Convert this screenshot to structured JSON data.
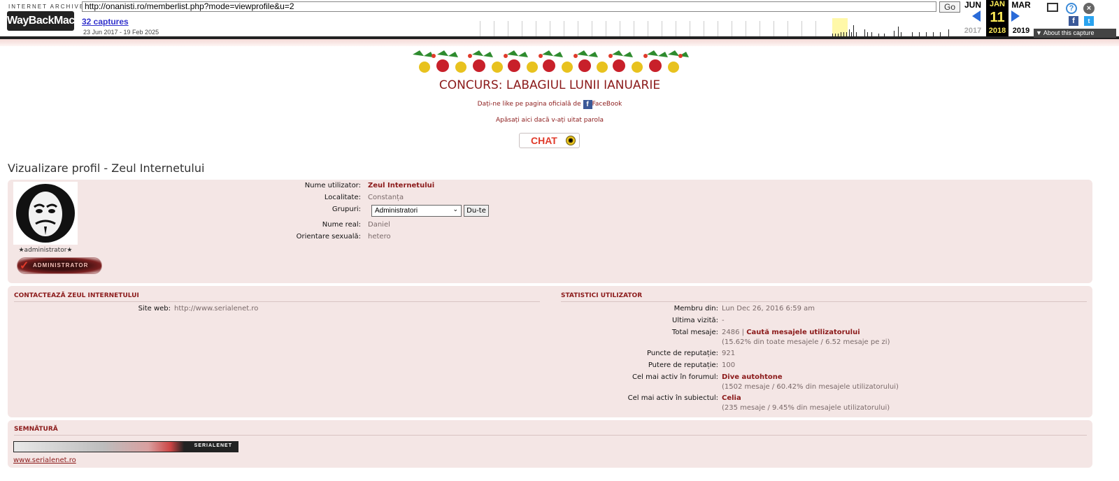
{
  "wayback": {
    "logo_top": "INTERNET ARCHIVE",
    "logo": "WayBackMachine",
    "url": "http://onanisti.ro/memberlist.php?mode=viewprofile&u=2",
    "go": "Go",
    "captures": "32 captures",
    "range": "23 Jun 2017 - 19 Feb 2025",
    "prev_month": "JUN",
    "cur_month": "JAN",
    "next_month": "MAR",
    "cur_day": "11",
    "prev_year": "2017",
    "cur_year": "2018",
    "next_year": "2019",
    "about": "▼ About this capture"
  },
  "header": {
    "contest": "CONCURS: LABAGIUL LUNII IANUARIE",
    "like_prefix": "Dați-ne like pe pagina oficială de",
    "like_suffix": "FaceBook",
    "forgot": "Apăsați aici dacă v-ați uitat parola",
    "chat": "CHAT"
  },
  "page_title": "Vizualizare profil - Zeul Internetului",
  "profile": {
    "rank_text": "★administrator★",
    "rank_image": "ADMINISTRATOR",
    "fields": [
      {
        "label": "Nume utilizator:",
        "value": "Zeul Internetului"
      },
      {
        "label": "Localitate:",
        "value": "Constanța"
      },
      {
        "label": "Grupuri:",
        "value": "Administratori"
      },
      {
        "label": "Nume real:",
        "value": "Daniel"
      },
      {
        "label": "Orientare sexuală:",
        "value": "hetero"
      }
    ],
    "go_button": "Du-te"
  },
  "contact": {
    "title": "CONTACTEAZĂ ZEUL INTERNETULUI",
    "site_label": "Site web:",
    "site_value": "http://www.serialenet.ro"
  },
  "stats": {
    "title": "STATISTICI UTILIZATOR",
    "member_since_label": "Membru din:",
    "member_since": "Lun Dec 26, 2016 6:59 am",
    "last_visit_label": "Ultima vizită:",
    "last_visit": "-",
    "total_posts_label": "Total mesaje:",
    "total_posts": "2486",
    "separator": "|",
    "search_posts": "Caută mesajele utilizatorului",
    "total_posts_sub": "(15.62% din toate mesajele / 6.52 mesaje pe zi)",
    "rep_points_label": "Puncte de reputație:",
    "rep_points": "921",
    "rep_power_label": "Putere de reputație:",
    "rep_power": "100",
    "active_forum_label": "Cel mai activ în forumul:",
    "active_forum": "Dive autohtone",
    "active_forum_sub": "(1502 mesaje / 60.42% din mesajele utilizatorului)",
    "active_topic_label": "Cel mai activ în subiectul:",
    "active_topic": "Celia",
    "active_topic_sub": "(235 mesaje / 9.45% din mesajele utilizatorului)"
  },
  "signature": {
    "title": "SEMNĂTURĂ",
    "banner_text": "SERIALENET",
    "link": "www.serialenet.ro"
  }
}
